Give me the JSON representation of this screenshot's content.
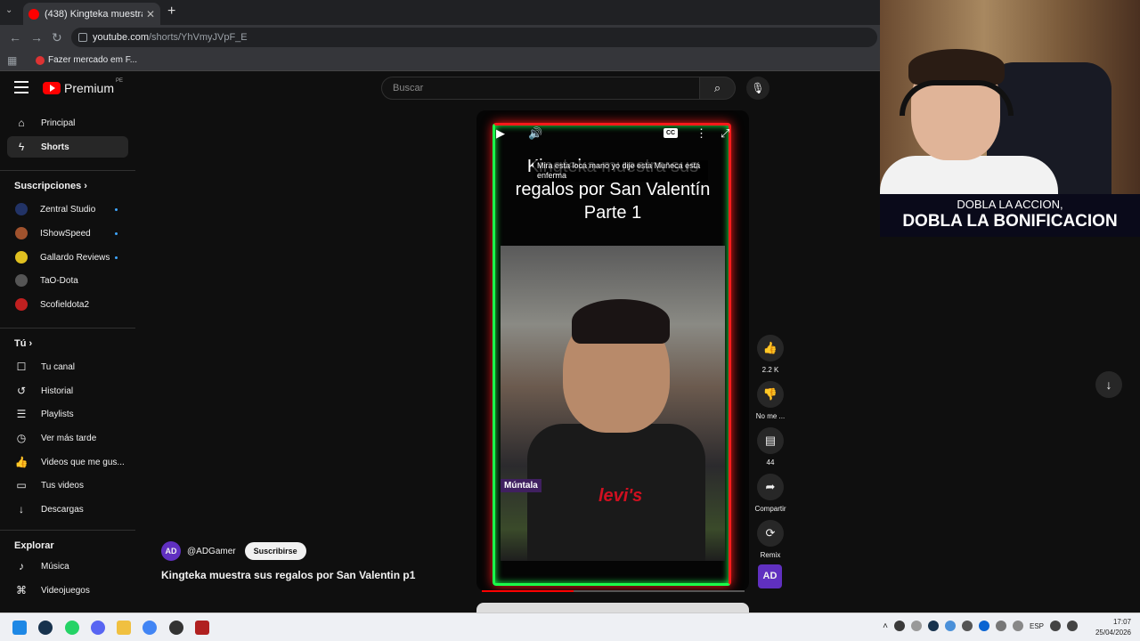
{
  "browser": {
    "tab_title": "(438) Kingteka muestra sus rega",
    "url_domain": "youtube.com",
    "url_path": "/shorts/YhVmyJVpF_E",
    "bookmark": "Fazer mercado em F..."
  },
  "header": {
    "logo_text": "Premium",
    "logo_region": "PE",
    "search_placeholder": "Buscar"
  },
  "sidebar": {
    "main": [
      {
        "label": "Principal",
        "icon": "home-icon"
      },
      {
        "label": "Shorts",
        "icon": "shorts-icon"
      }
    ],
    "subscriptions_heading": "Suscripciones",
    "subscriptions": [
      {
        "label": "Zentral Studio",
        "color": "#223366"
      },
      {
        "label": "IShowSpeed",
        "color": "#a0522d"
      },
      {
        "label": "Gallardo Reviews",
        "color": "#e0c020"
      },
      {
        "label": "TaO-Dota",
        "color": "#555555"
      },
      {
        "label": "Scofieldota2",
        "color": "#c02020"
      }
    ],
    "you_heading": "Tú",
    "you": [
      {
        "label": "Tu canal"
      },
      {
        "label": "Historial"
      },
      {
        "label": "Playlists"
      },
      {
        "label": "Ver más tarde"
      },
      {
        "label": "Videos que me gus..."
      },
      {
        "label": "Tus videos"
      },
      {
        "label": "Descargas"
      }
    ],
    "explore_heading": "Explorar",
    "explore": [
      {
        "label": "Música"
      },
      {
        "label": "Videojuegos"
      }
    ]
  },
  "short": {
    "overlay_title": "Kingteka muestra sus regalos por San Valentín Parte 1",
    "subtitle": "Mira esta loca mano yo dije esta Muñeca está enferma",
    "tag": "Múntala",
    "shirt_text": "levi's",
    "cc": "CC",
    "progress": 0.35
  },
  "actions": {
    "like_count": "2.2 K",
    "dislike_label": "No me ...",
    "comments_count": "44",
    "share_label": "Compartir",
    "remix_label": "Remix",
    "avatar_text": "AD"
  },
  "channel": {
    "handle": "@ADGamer",
    "subscribe_label": "Suscribirse",
    "avatar_text": "AD"
  },
  "video_title": "Kingteka muestra sus regalos por San Valentin p1",
  "webcam": {
    "caption_line1": "DOBLA LA ACCION,",
    "caption_line2": "DOBLA LA BONIFICACION"
  },
  "taskbar": {
    "lang": "ESP",
    "time": "17:07",
    "date": "25/04/2026"
  }
}
